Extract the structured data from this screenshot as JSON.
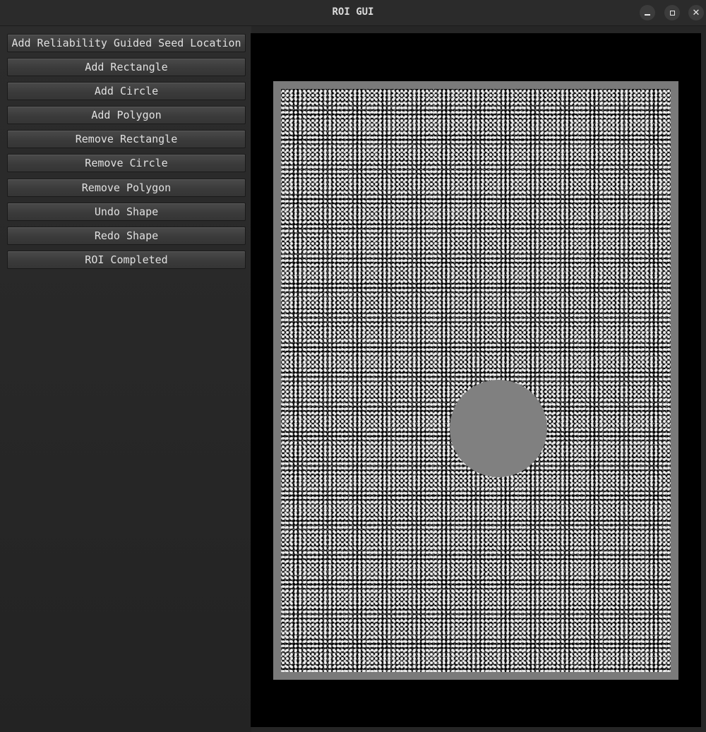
{
  "window": {
    "title": "ROI GUI",
    "controls": {
      "minimize": "minimize-icon",
      "maximize": "maximize-icon",
      "close": "close-icon"
    }
  },
  "sidebar": {
    "buttons": [
      {
        "label": "Add Reliability Guided Seed Location"
      },
      {
        "label": "Add Rectangle"
      },
      {
        "label": "Add Circle"
      },
      {
        "label": "Add Polygon"
      },
      {
        "label": "Remove Rectangle"
      },
      {
        "label": "Remove Circle"
      },
      {
        "label": "Remove Polygon"
      },
      {
        "label": "Undo Shape"
      },
      {
        "label": "Redo Shape"
      },
      {
        "label": "ROI Completed"
      }
    ]
  },
  "canvas": {
    "background_color": "#000000",
    "image": "speckle-pattern",
    "shapes": [
      {
        "type": "circle",
        "color": "#808080"
      }
    ]
  }
}
